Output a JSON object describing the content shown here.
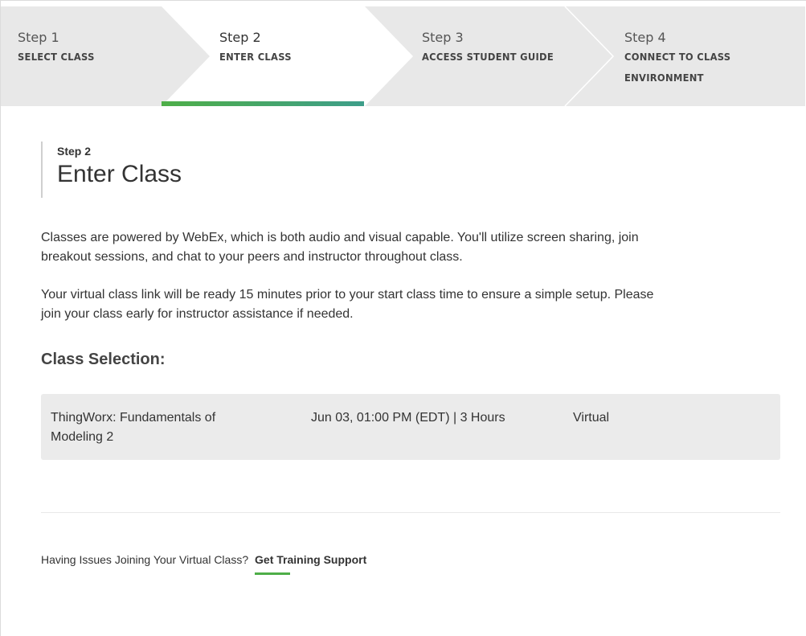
{
  "stepper": {
    "steps": [
      {
        "number": "Step 1",
        "title": "SELECT CLASS"
      },
      {
        "number": "Step 2",
        "title": "ENTER CLASS"
      },
      {
        "number": "Step 3",
        "title": "ACCESS STUDENT GUIDE"
      },
      {
        "number": "Step 4",
        "title": "CONNECT TO CLASS",
        "title2": "ENVIRONMENT"
      }
    ],
    "active_index": 1,
    "active_color": "#4eae48"
  },
  "content": {
    "eyebrow": "Step 2",
    "title": "Enter Class",
    "paragraph1_line1": "Classes are powered by WebEx, which is both audio and visual capable. You'll utilize screen sharing, join",
    "paragraph1_line2": "breakout sessions, and chat to your peers and instructor throughout class.",
    "paragraph2_line1": "Your virtual class link will be ready 15 minutes prior to your start class time to ensure a simple setup. Please",
    "paragraph2_line2": "join your class early for instructor assistance if needed.",
    "section_title": "Class Selection:",
    "class_selection": {
      "name_line1": "ThingWorx: Fundamentals of",
      "name_line2": "Modeling 2",
      "schedule": "Jun 03, 01:00 PM (EDT) | 3 Hours",
      "format": "Virtual"
    }
  },
  "footer": {
    "question": "Having Issues Joining Your Virtual Class?",
    "link": "Get Training Support"
  }
}
